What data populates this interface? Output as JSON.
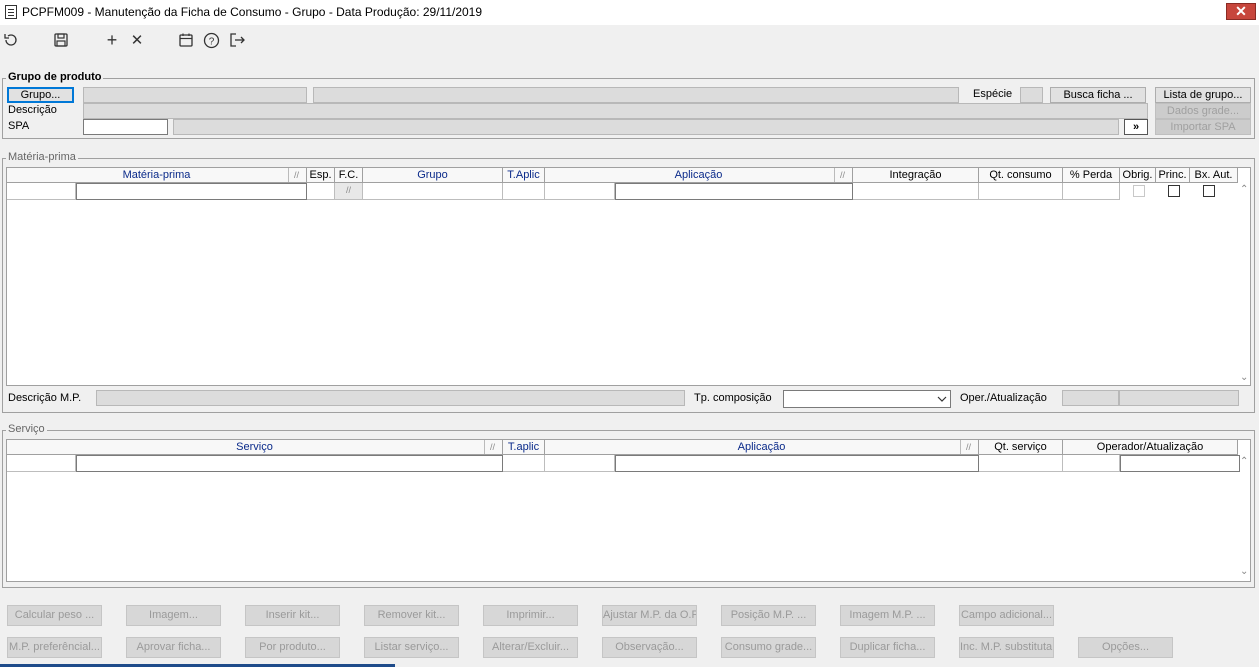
{
  "window": {
    "title": "PCPFM009 - Manutenção da Ficha de Consumo - Grupo - Data Produção: 29/11/2019",
    "close": "✕"
  },
  "toolbar": {
    "refresh": "refresh-icon",
    "save": "save-icon",
    "add": "+",
    "delete": "✕",
    "calendar": "calendar-icon",
    "help": "?",
    "exit": "exit-icon"
  },
  "grupo": {
    "legend": "Grupo de produto",
    "grupo_btn": "Grupo...",
    "descricao": "Descrição",
    "spa": "SPA",
    "especie": "Espécie",
    "busca": "Busca ficha ...",
    "lista": "Lista de grupo...",
    "dados": "Dados grade...",
    "importar": "Importar SPA",
    "spa_btn": "»"
  },
  "mp": {
    "legend": "Matéria-prima",
    "cols": [
      "Matéria-prima",
      "Esp.",
      "F.C.",
      "Grupo",
      "T.Aplic",
      "Aplicação",
      "Integração",
      "Qt. consumo",
      "% Perda",
      "Obrig.",
      "Princ.",
      "Bx. Aut."
    ],
    "fc_cell": "//",
    "descricao": "Descrição M.P.",
    "tp": "Tp. composição",
    "oper": "Oper./Atualização"
  },
  "servico": {
    "legend": "Serviço",
    "cols": [
      "Serviço",
      "T.aplic",
      "Aplicação",
      "Qt. serviço",
      "Operador/Atualização"
    ]
  },
  "buttons_row1": [
    "Calcular peso ...",
    "Imagem...",
    "Inserir kit...",
    "Remover kit...",
    "Imprimir...",
    "Ajustar M.P. da O.P...",
    "Posição M.P. ...",
    "Imagem M.P. ...",
    "Campo adicional..."
  ],
  "buttons_row2": [
    "M.P. preferêncial...",
    "Aprovar ficha...",
    "Por produto...",
    "Listar serviço...",
    "Alterar/Excluir...",
    "Observação...",
    "Consumo grade...",
    "Duplicar ficha...",
    "Inc. M.P. substituta...",
    "Opções..."
  ]
}
